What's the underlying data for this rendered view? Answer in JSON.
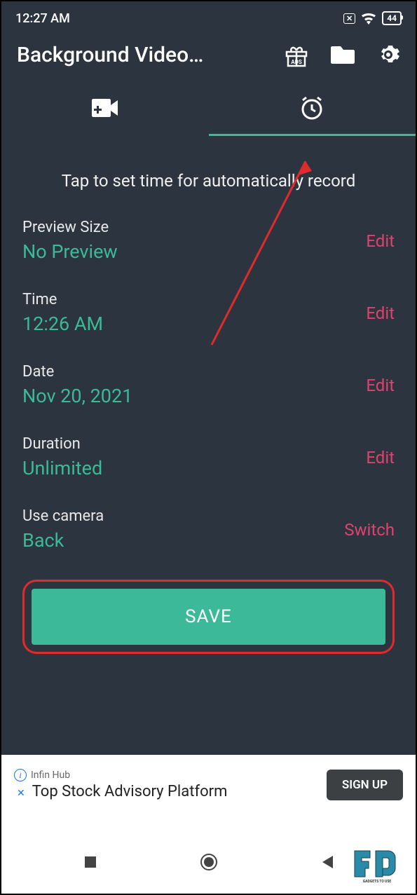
{
  "status": {
    "time": "12:27 AM",
    "battery": "44"
  },
  "header": {
    "title": "Background Video…"
  },
  "instruction": "Tap to set time for automatically record",
  "settings": {
    "preview": {
      "label": "Preview Size",
      "value": "No Preview",
      "action": "Edit"
    },
    "time": {
      "label": "Time",
      "value": "12:26 AM",
      "action": "Edit"
    },
    "date": {
      "label": "Date",
      "value": "Nov 20, 2021",
      "action": "Edit"
    },
    "duration": {
      "label": "Duration",
      "value": "Unlimited",
      "action": "Edit"
    },
    "camera": {
      "label": "Use camera",
      "value": "Back",
      "action": "Switch"
    }
  },
  "save_button": "SAVE",
  "ad": {
    "advertiser": "Infin Hub",
    "headline": "Top Stock Advisory Platform",
    "cta": "SIGN UP"
  },
  "watermark": {
    "text": "GADGETS TO USE"
  }
}
